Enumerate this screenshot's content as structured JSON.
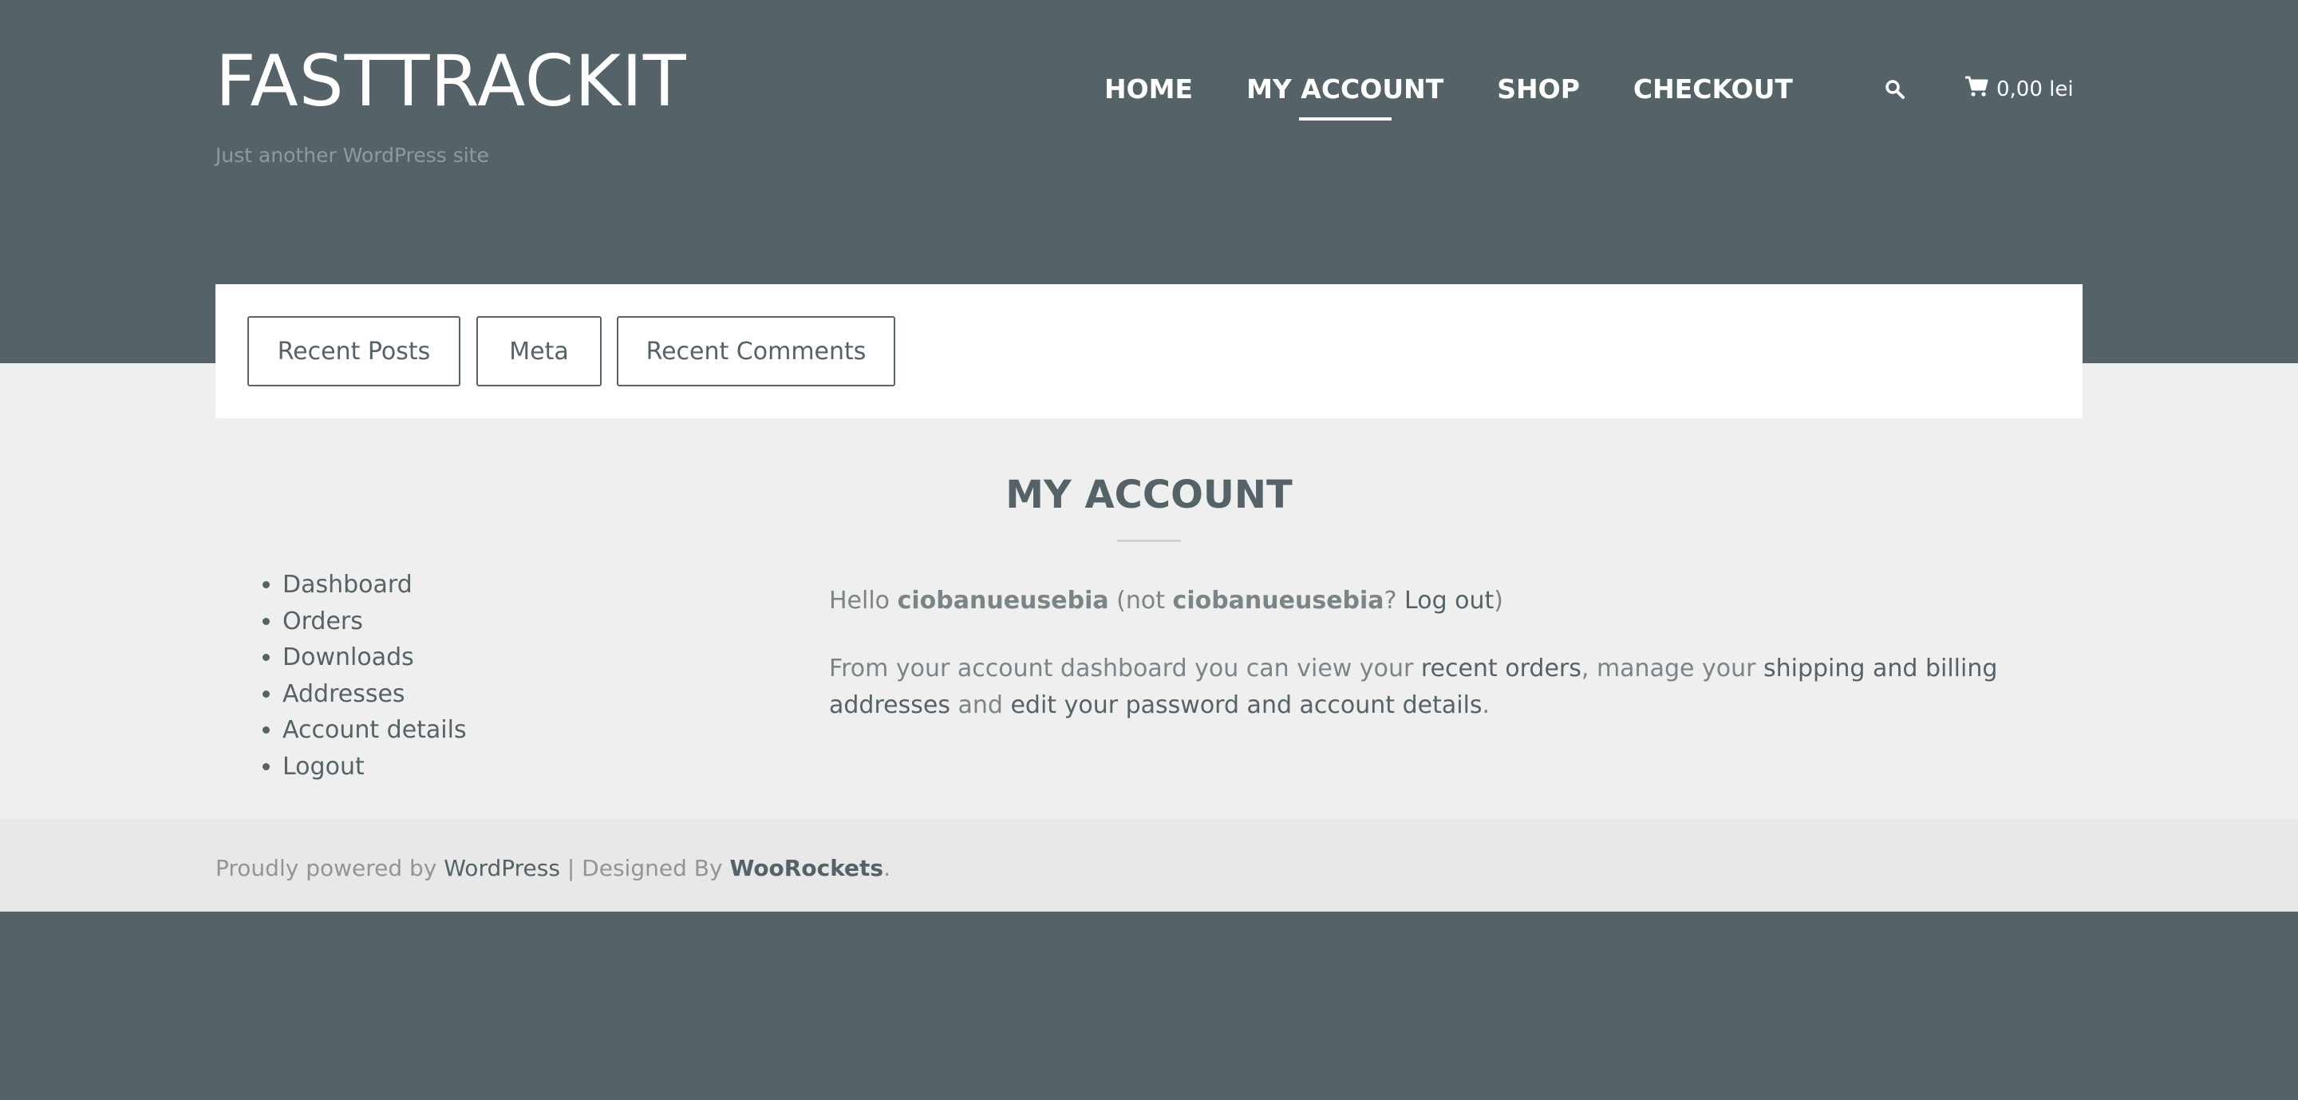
{
  "site": {
    "title": "FASTTRACKIT",
    "tagline": "Just another WordPress site"
  },
  "nav": {
    "items": [
      "HOME",
      "MY ACCOUNT",
      "SHOP",
      "CHECKOUT"
    ],
    "active": "MY ACCOUNT"
  },
  "cart": {
    "amount": "0,00 lei",
    "icon": "cart-icon"
  },
  "search": {
    "icon": "search-icon"
  },
  "widgets": [
    "Recent Posts",
    "Meta",
    "Recent Comments"
  ],
  "page": {
    "title": "MY ACCOUNT"
  },
  "account_nav": [
    "Dashboard",
    "Orders",
    "Downloads",
    "Addresses",
    "Account details",
    "Logout"
  ],
  "greeting": {
    "hello": "Hello ",
    "username": "ciobanueusebia",
    "not_prefix": " (not ",
    "username2": "ciobanueusebia",
    "q_mark": "? ",
    "logout": "Log out",
    "close": ")"
  },
  "dashboard_text": {
    "part1": "From your account dashboard you can view your ",
    "recent_orders": "recent orders",
    "part2": ", manage your ",
    "addresses": "shipping and billing addresses",
    "part3": " and ",
    "account_details": "edit your password and account details",
    "part4": "."
  },
  "footer": {
    "powered": "Proudly powered by ",
    "wordpress": "WordPress",
    "sep": " | Designed By ",
    "designer": "WooRockets",
    "end": "."
  },
  "colors": {
    "header_bg": "#556267",
    "content_bg": "#efefef",
    "footer_bg": "#e8e8e8",
    "text": "#556267"
  }
}
